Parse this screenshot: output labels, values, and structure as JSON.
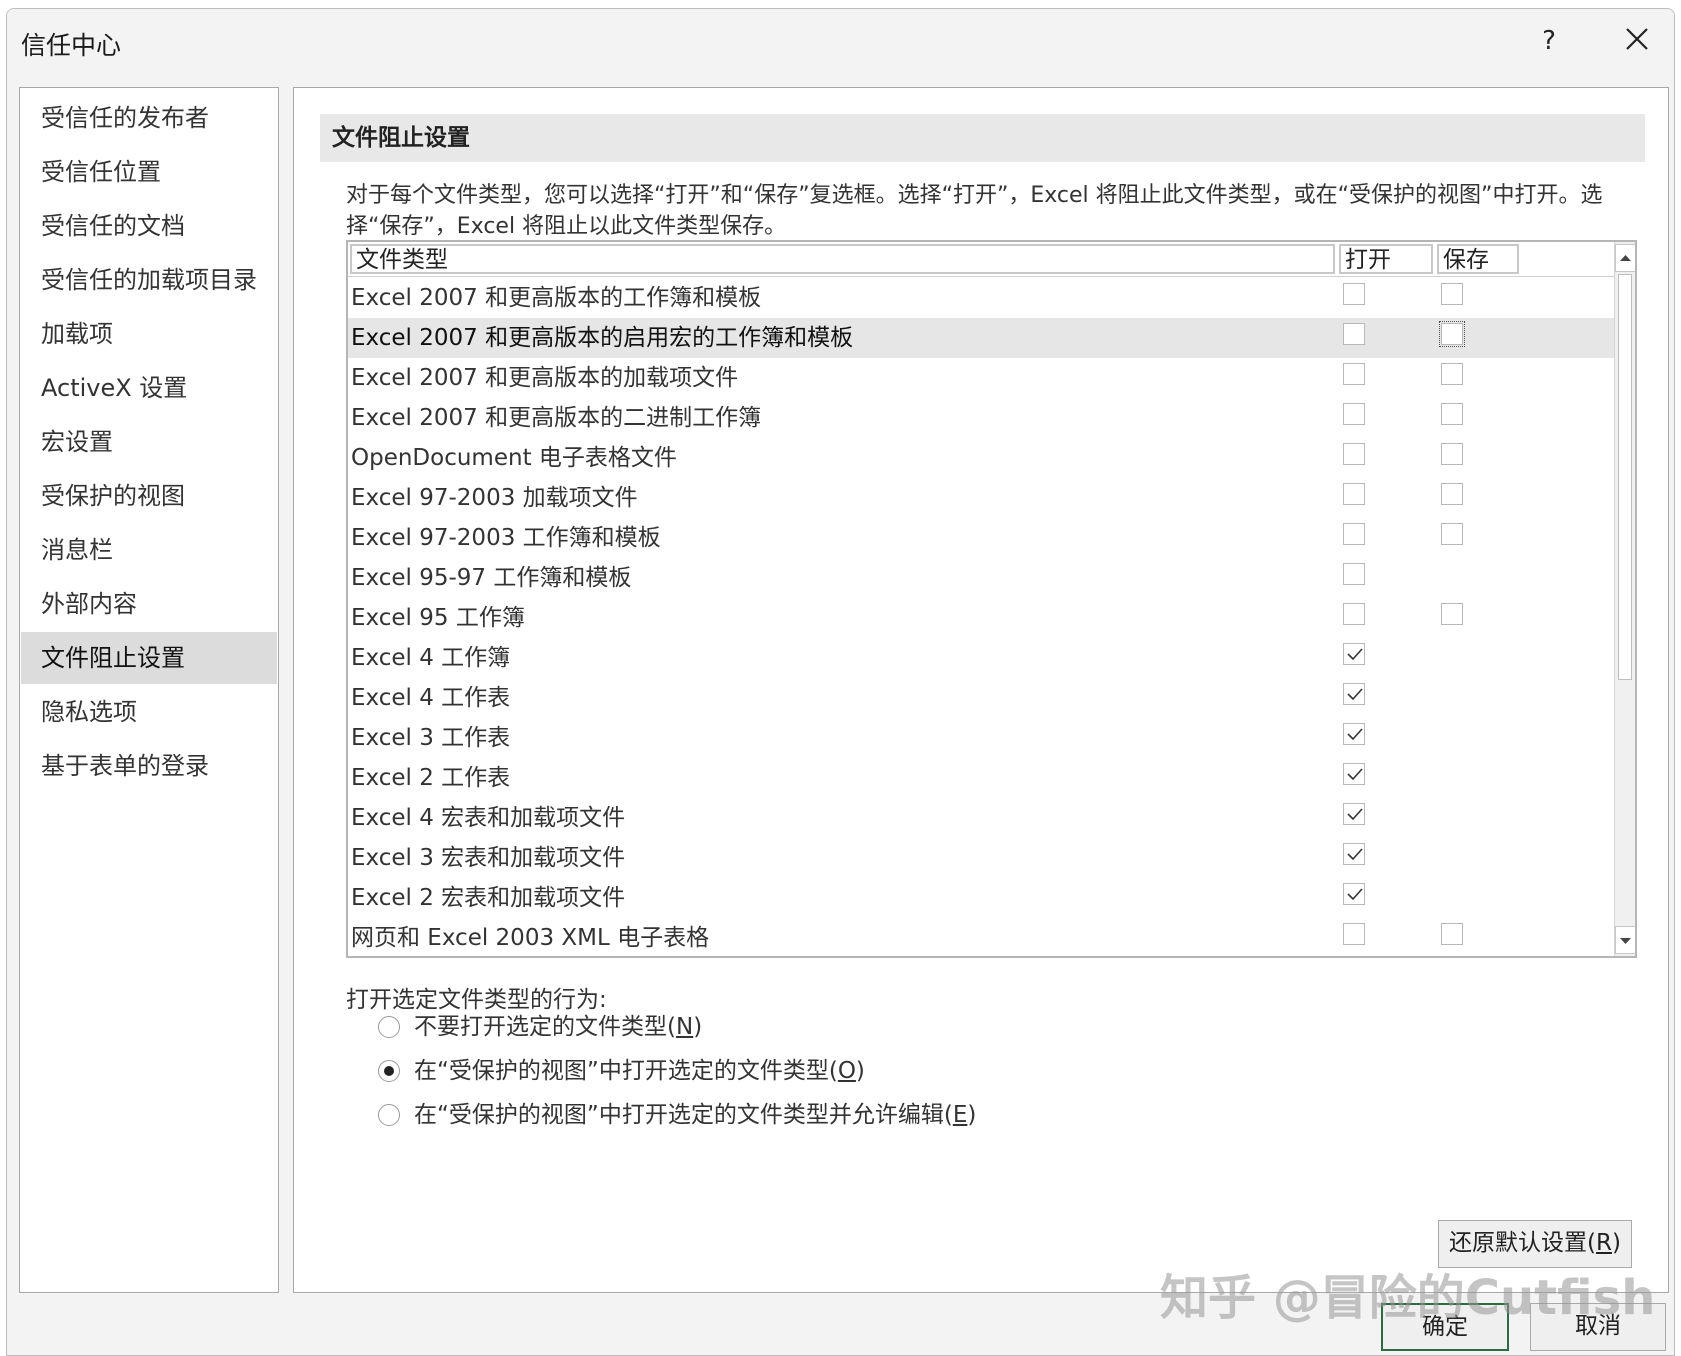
{
  "window": {
    "title": "信任中心",
    "help": "?",
    "close": "✕"
  },
  "sidebar": {
    "items": [
      {
        "label": "受信任的发布者"
      },
      {
        "label": "受信任位置"
      },
      {
        "label": "受信任的文档"
      },
      {
        "label": "受信任的加载项目录"
      },
      {
        "label": "加载项"
      },
      {
        "label": "ActiveX 设置"
      },
      {
        "label": "宏设置"
      },
      {
        "label": "受保护的视图"
      },
      {
        "label": "消息栏"
      },
      {
        "label": "外部内容"
      },
      {
        "label": "文件阻止设置"
      },
      {
        "label": "隐私选项"
      },
      {
        "label": "基于表单的登录"
      }
    ],
    "active_index": 10
  },
  "main": {
    "section_title": "文件阻止设置",
    "description": "对于每个文件类型，您可以选择“打开”和“保存”复选框。选择“打开”，Excel 将阻止此文件类型，或在“受保护的视图”中打开。选择“保存”，Excel 将阻止以此文件类型保存。",
    "table": {
      "headers": {
        "file_type": "文件类型",
        "open": "打开",
        "save": "保存"
      },
      "rows": [
        {
          "label": "Excel 2007 和更高版本的工作簿和模板",
          "open": false,
          "save": false,
          "has_save": true
        },
        {
          "label": "Excel 2007 和更高版本的启用宏的工作簿和模板",
          "open": false,
          "save": false,
          "has_save": true,
          "selected": true
        },
        {
          "label": "Excel 2007 和更高版本的加载项文件",
          "open": false,
          "save": false,
          "has_save": true
        },
        {
          "label": "Excel 2007 和更高版本的二进制工作簿",
          "open": false,
          "save": false,
          "has_save": true
        },
        {
          "label": "OpenDocument 电子表格文件",
          "open": false,
          "save": false,
          "has_save": true
        },
        {
          "label": "Excel 97-2003 加载项文件",
          "open": false,
          "save": false,
          "has_save": true
        },
        {
          "label": "Excel 97-2003 工作簿和模板",
          "open": false,
          "save": false,
          "has_save": true
        },
        {
          "label": "Excel 95-97 工作簿和模板",
          "open": false,
          "save": false,
          "has_save": false
        },
        {
          "label": "Excel 95 工作簿",
          "open": false,
          "save": false,
          "has_save": true
        },
        {
          "label": "Excel 4 工作簿",
          "open": true,
          "save": false,
          "has_save": false
        },
        {
          "label": "Excel 4 工作表",
          "open": true,
          "save": false,
          "has_save": false
        },
        {
          "label": "Excel 3 工作表",
          "open": true,
          "save": false,
          "has_save": false
        },
        {
          "label": "Excel 2 工作表",
          "open": true,
          "save": false,
          "has_save": false
        },
        {
          "label": "Excel 4 宏表和加载项文件",
          "open": true,
          "save": false,
          "has_save": false
        },
        {
          "label": "Excel 3 宏表和加载项文件",
          "open": true,
          "save": false,
          "has_save": false
        },
        {
          "label": "Excel 2 宏表和加载项文件",
          "open": true,
          "save": false,
          "has_save": false
        },
        {
          "label": "网页和 Excel 2003 XML 电子表格",
          "open": false,
          "save": false,
          "has_save": true
        }
      ]
    },
    "behavior": {
      "label": "打开选定文件类型的行为:",
      "options": [
        {
          "text": "不要打开选定的文件类型(",
          "key": "N",
          "suffix": ")",
          "checked": false
        },
        {
          "text": "在“受保护的视图”中打开选定的文件类型(",
          "key": "O",
          "suffix": ")",
          "checked": true
        },
        {
          "text": "在“受保护的视图”中打开选定的文件类型并允许编辑(",
          "key": "E",
          "suffix": ")",
          "checked": false
        }
      ]
    },
    "restore_button": {
      "text": "还原默认设置(",
      "key": "R",
      "suffix": ")"
    }
  },
  "footer": {
    "ok": "确定",
    "cancel": "取消"
  },
  "watermark": "知乎 @冒险的Cutfish"
}
